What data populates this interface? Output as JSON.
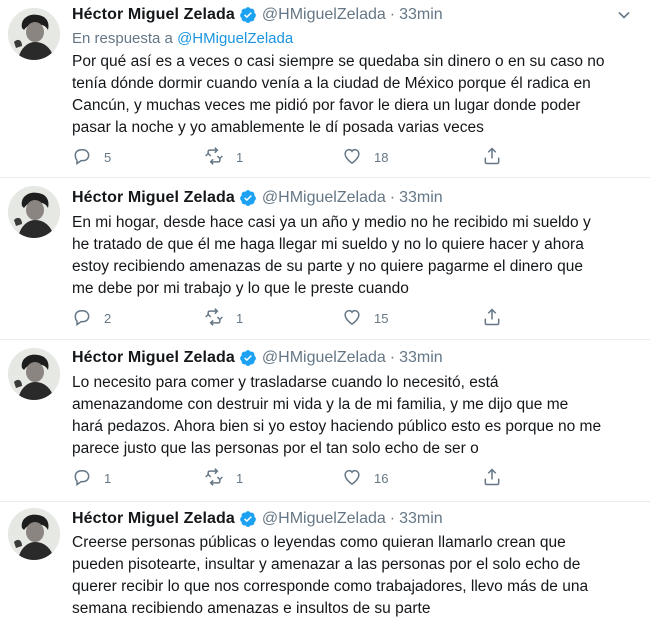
{
  "tweets": [
    {
      "name": "Héctor Miguel Zelada",
      "handle": "@HMiguelZelada",
      "time": "33min",
      "reply_prefix": "En respuesta a",
      "reply_handle": "@HMiguelZelada",
      "text": "Por qué así es a veces o casi siempre se quedaba sin dinero o en su caso no\ntenía dónde dormir cuando venía a la ciudad de México porque él radica en\nCancún, y muchas veces me pidió por favor le diera un lugar donde poder\npasar la noche y yo amablemente le dí posada varias veces",
      "replies": "5",
      "retweets": "1",
      "likes": "18"
    },
    {
      "name": "Héctor Miguel Zelada",
      "handle": "@HMiguelZelada",
      "time": "33min",
      "text": "En mi hogar, desde hace casi ya un año y medio no he recibido mi sueldo y\nhe tratado de que él me haga llegar mi sueldo y no lo quiere hacer y ahora\nestoy recibiendo amenazas de su parte y no quiere pagarme el dinero que\nme debe por mi trabajo y lo que le preste cuando",
      "replies": "2",
      "retweets": "1",
      "likes": "15"
    },
    {
      "name": "Héctor Miguel Zelada",
      "handle": "@HMiguelZelada",
      "time": "33min",
      "text": "Lo necesito para comer y trasladarse cuando lo necesitó, está\namenazandome con destruir mi vida y la de mi familia, y me dijo que me\nhará pedazos. Ahora bien si yo estoy haciendo público esto es porque no me\nparece justo que las personas por el tan solo echo de ser o",
      "replies": "1",
      "retweets": "1",
      "likes": "16"
    },
    {
      "name": "Héctor Miguel Zelada",
      "handle": "@HMiguelZelada",
      "time": "33min",
      "text": "Creerse personas públicas o leyendas como quieran llamarlo crean que\npueden pisotearte, insultar y amenazar a las personas por el solo echo de\nquerer recibir lo que nos corresponde como trabajadores, llevo más de una\nsemana recibiendo amenazas e insultos de su parte"
    }
  ],
  "separator": "·",
  "icons": {
    "reply": "reply-icon",
    "retweet": "retweet-icon",
    "like": "heart-icon",
    "share": "share-icon",
    "verified": "verified-badge-icon",
    "caret": "chevron-down-icon"
  },
  "colors": {
    "name": "#14171a",
    "muted": "#657786",
    "link": "#1b95e0",
    "verified": "#1da1f2",
    "divider": "#e6ecf0"
  }
}
